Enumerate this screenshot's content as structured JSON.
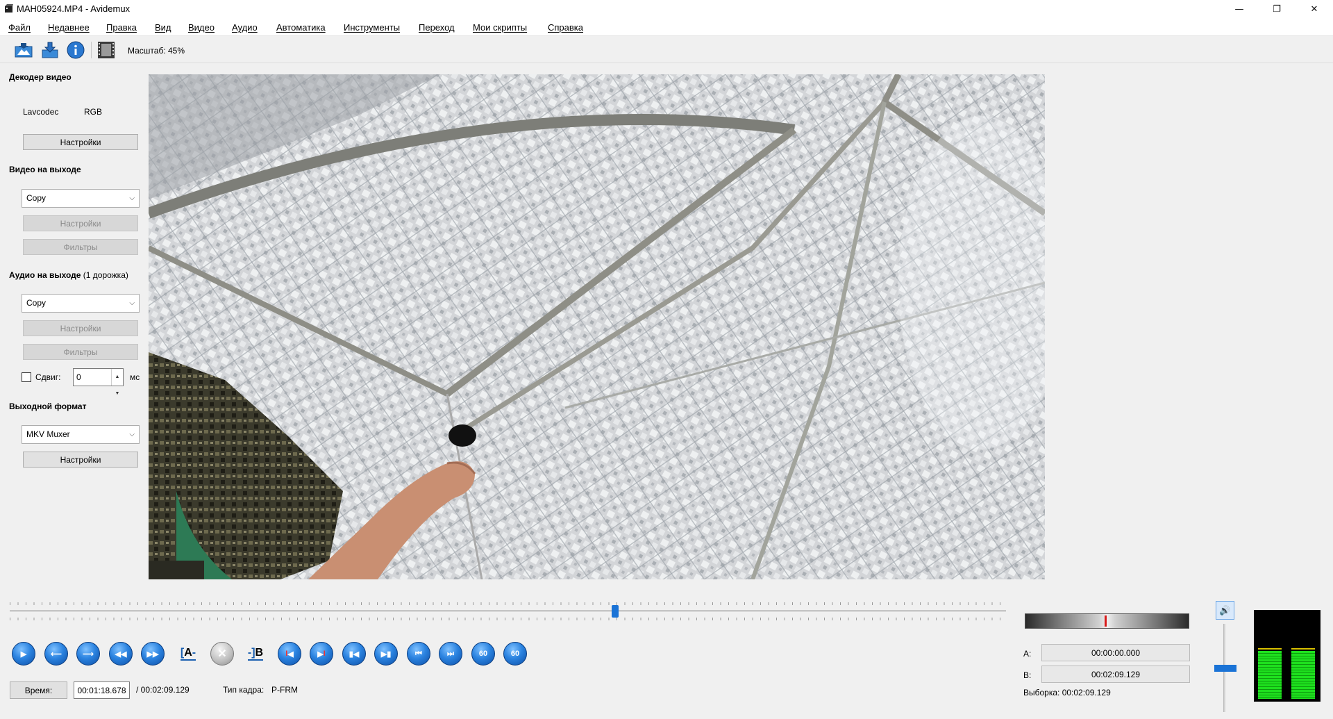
{
  "window": {
    "title": "MAH05924.MP4 - Avidemux",
    "minimize_glyph": "—",
    "restore_glyph": "❐",
    "close_glyph": "✕"
  },
  "menu": [
    "Файл",
    "Недавнее",
    "Правка",
    "Вид",
    "Видео",
    "Аудио",
    "Автоматика",
    "Инструменты",
    "Переход",
    "Мои скрипты",
    "Справка"
  ],
  "toolbar": {
    "icons": [
      "open-video-icon",
      "save-video-icon",
      "properties-info-icon",
      "film-strip-icon"
    ],
    "zoom_label": "Масштаб: 45%"
  },
  "left_panel": {
    "decoder": {
      "title": "Декодер видео",
      "codec": "Lavcodec",
      "colorspace": "RGB",
      "settings_label": "Настройки"
    },
    "video_output": {
      "title": "Видео на выходе",
      "codec_value": "Copy",
      "settings_label": "Настройки",
      "filters_label": "Фильтры"
    },
    "audio_output": {
      "title": "Аудио на выходе",
      "track_note": "(1 дорожка)",
      "codec_value": "Copy",
      "settings_label": "Настройки",
      "filters_label": "Фильтры",
      "shift_label": "Сдвиг:",
      "shift_checked": false,
      "shift_value": "0",
      "shift_unit": "мс"
    },
    "output_format": {
      "title": "Выходной формат",
      "muxer_value": "MKV Muxer",
      "settings_label": "Настройки"
    }
  },
  "timeline": {
    "position_fraction": 0.6079
  },
  "transport": {
    "buttons": [
      "play-icon",
      "previous-frame-icon",
      "next-frame-icon",
      "rewind-icon",
      "fast-forward-icon",
      "set-marker-a-icon",
      "delete-selection-icon",
      "set-marker-b-icon",
      "go-to-marker-a-icon",
      "go-to-marker-b-icon",
      "previous-keyframe-icon",
      "next-keyframe-icon",
      "go-to-first-frame-icon",
      "go-to-last-frame-icon",
      "back-60-seconds-icon",
      "forward-60-seconds-icon"
    ],
    "marker_a_text": "A",
    "marker_b_text": "B",
    "seek_back_text": "60",
    "seek_fwd_text": "60"
  },
  "status": {
    "time_button_label": "Время:",
    "current_time": "00:01:18.678",
    "total_time": "/ 00:02:09.129",
    "frame_type_label": "Тип кадра:",
    "frame_type_value": "P-FRM"
  },
  "selection": {
    "a_label": "A:",
    "a_value": "00:00:00.000",
    "b_label": "B:",
    "b_value": "00:02:09.129",
    "selection_text": "Выборка: 00:02:09.129"
  },
  "audio": {
    "volume_icon": "speaker-icon",
    "volume_level": 0.5,
    "meter_left_level": 0.56,
    "meter_right_level": 0.56
  },
  "colors": {
    "accent": "#1a73d6",
    "meter_green": "#1ee01e",
    "needle_red": "#d81b1b"
  }
}
